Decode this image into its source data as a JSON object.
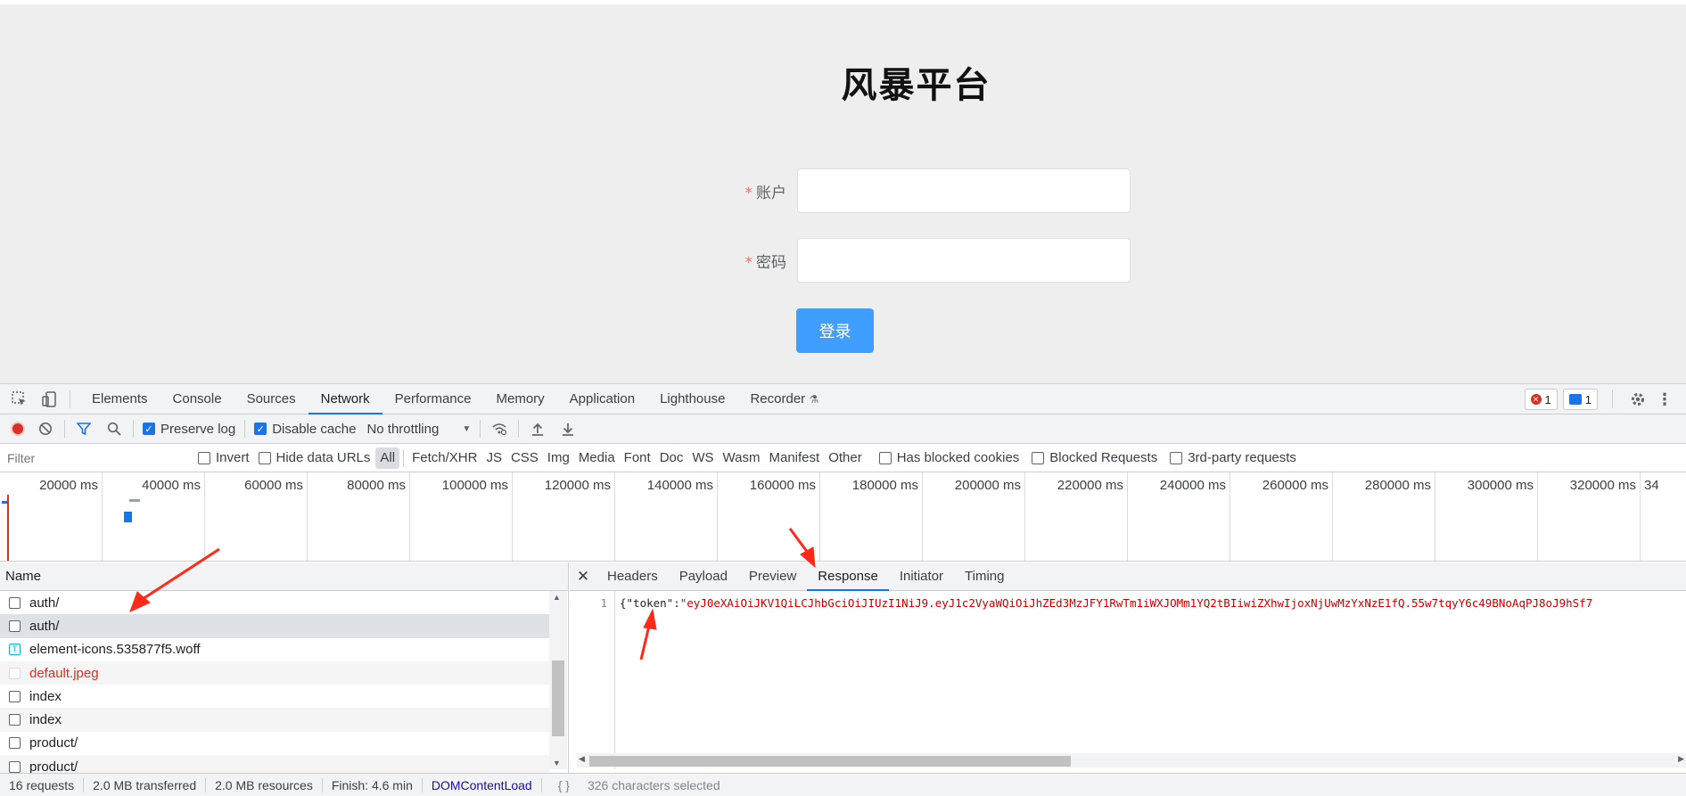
{
  "page": {
    "title": "风暴平台",
    "account_label": "账户",
    "password_label": "密码",
    "required_mark": "*",
    "account_value": "",
    "password_value": "",
    "login_label": "登录"
  },
  "devtools": {
    "tabs": [
      "Elements",
      "Console",
      "Sources",
      "Network",
      "Performance",
      "Memory",
      "Application",
      "Lighthouse",
      "Recorder"
    ],
    "active_tab": "Network",
    "error_count": "1",
    "message_count": "1",
    "toolbar": {
      "preserve_log": "Preserve log",
      "disable_cache": "Disable cache",
      "throttling": "No throttling"
    },
    "filter": {
      "placeholder": "Filter",
      "invert": "Invert",
      "hide_data_urls": "Hide data URLs",
      "types": [
        "All",
        "Fetch/XHR",
        "JS",
        "CSS",
        "Img",
        "Media",
        "Font",
        "Doc",
        "WS",
        "Wasm",
        "Manifest",
        "Other"
      ],
      "has_blocked_cookies": "Has blocked cookies",
      "blocked_requests": "Blocked Requests",
      "third_party": "3rd-party requests"
    },
    "timeline_ticks": [
      "20000 ms",
      "40000 ms",
      "60000 ms",
      "80000 ms",
      "100000 ms",
      "120000 ms",
      "140000 ms",
      "160000 ms",
      "180000 ms",
      "200000 ms",
      "220000 ms",
      "240000 ms",
      "260000 ms",
      "280000 ms",
      "300000 ms",
      "320000 ms",
      "34"
    ],
    "list_header": "Name",
    "requests": [
      "auth/",
      "auth/",
      "element-icons.535877f5.woff",
      "default.jpeg",
      "index",
      "index",
      "product/",
      "product/"
    ],
    "detail_tabs": [
      "Headers",
      "Payload",
      "Preview",
      "Response",
      "Initiator",
      "Timing"
    ],
    "active_detail_tab": "Response",
    "response": {
      "line_number": "1",
      "prefix": "{\"token\":",
      "value": "\"eyJ0eXAiOiJKV1QiLCJhbGciOiJIUzI1NiJ9.eyJ1c2VyaWQiOiJhZEd3MzJFY1RwTm1iWXJOMm1YQ2tBIiwiZXhwIjoxNjUwMzYxNzE1fQ.55w7tqyY6c49BNoAqPJ8oJ9hSf7"
    },
    "status": {
      "requests": "16 requests",
      "transferred": "2.0 MB transferred",
      "resources": "2.0 MB resources",
      "finish": "Finish: 4.6 min",
      "dcl": "DOMContentLoad",
      "selection": "326 characters selected"
    }
  },
  "colors": {
    "primary": "#409eff",
    "required": "#f56c6c",
    "devtools_accent": "#1a73e8",
    "string_red": "#c80000",
    "annotation_arrow": "#ff2a1a"
  }
}
